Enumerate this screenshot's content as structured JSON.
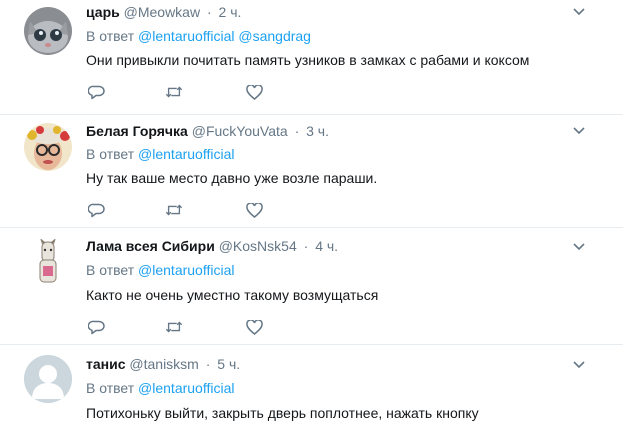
{
  "tweets": [
    {
      "name": "царь",
      "handle": "@Meowkaw",
      "separator": "·",
      "time": "2 ч.",
      "reply_prefix": "В ответ",
      "mentions": [
        "@lentaruofficial",
        "@sangdrag"
      ],
      "text": "Они привыкли почитать память узников в замках с рабами и коксом",
      "avatar_icon": "cat-face-avatar"
    },
    {
      "name": "Белая Горячка",
      "handle": "@FuckYouVata",
      "separator": "·",
      "time": "3 ч.",
      "reply_prefix": "В ответ",
      "mentions": [
        "@lentaruofficial"
      ],
      "text": "Ну так ваше место давно уже возле параши.",
      "avatar_icon": "woman-glasses-flowers-avatar"
    },
    {
      "name": "Лама всея Сибири",
      "handle": "@KosNsk54",
      "separator": "·",
      "time": "4 ч.",
      "reply_prefix": "В ответ",
      "mentions": [
        "@lentaruofficial"
      ],
      "text": "Както не очень уместно такому возмущаться",
      "avatar_icon": "llama-avatar"
    },
    {
      "name": "танис",
      "handle": "@tanisksm",
      "separator": "·",
      "time": "5 ч.",
      "reply_prefix": "В ответ",
      "mentions": [
        "@lentaruofficial"
      ],
      "text": "Потихоньку выйти, закрыть дверь поплотнее, нажать кнопку",
      "avatar_icon": "default-user-avatar"
    }
  ],
  "colors": {
    "link": "#1da1f2",
    "secondary_text": "#657786",
    "primary_text": "#14171a",
    "divider": "#e6ecf0"
  }
}
